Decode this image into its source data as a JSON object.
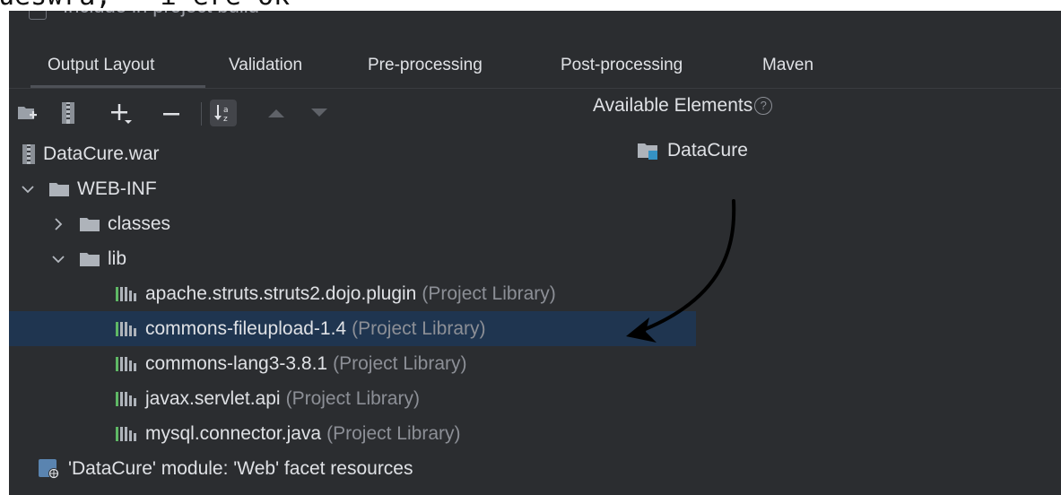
{
  "top_strip": {
    "text": "ueswra, - i-ere-ok"
  },
  "header": {
    "checkbox_label": "Include in project build"
  },
  "tabs": [
    {
      "label": "Output Layout",
      "active": true
    },
    {
      "label": "Validation"
    },
    {
      "label": "Pre-processing"
    },
    {
      "label": "Post-processing"
    },
    {
      "label": "Maven"
    }
  ],
  "toolbar": {
    "icons": [
      "new-directory-icon",
      "archive-icon",
      "add-icon",
      "remove-icon",
      "sort-alpha-icon",
      "move-up-icon",
      "move-down-icon"
    ]
  },
  "tree": {
    "war": "DataCure.war",
    "webinf": "WEB-INF",
    "classes": "classes",
    "lib": "lib",
    "libs": [
      {
        "name": "apache.struts.struts2.dojo.plugin",
        "note": "(Project Library)"
      },
      {
        "name": "commons-fileupload-1.4",
        "note": "(Project Library)"
      },
      {
        "name": "commons-lang3-3.8.1",
        "note": "(Project Library)"
      },
      {
        "name": "javax.servlet.api",
        "note": "(Project Library)"
      },
      {
        "name": "mysql.connector.java",
        "note": "(Project Library)"
      }
    ],
    "module_resources": "'DataCure' module: 'Web' facet resources"
  },
  "available": {
    "title": "Available Elements",
    "help": "?",
    "items": [
      {
        "label": "DataCure"
      }
    ]
  },
  "colors": {
    "panel_bg": "#2b2d30",
    "selection": "#1f3550",
    "text": "#dfe1e5",
    "muted": "#8c8f96",
    "accent": "#3592c4"
  }
}
